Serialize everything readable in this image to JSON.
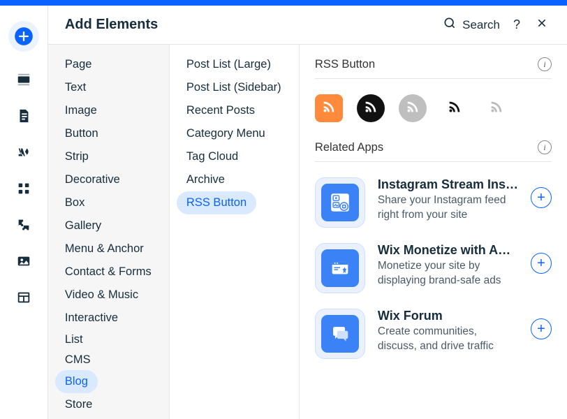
{
  "header": {
    "title": "Add Elements",
    "search_label": "Search",
    "help_label": "?"
  },
  "rail": {
    "items": [
      {
        "name": "add-icon"
      },
      {
        "name": "section-icon"
      },
      {
        "name": "page-icon"
      },
      {
        "name": "theme-icon"
      },
      {
        "name": "apps-icon"
      },
      {
        "name": "plugins-icon"
      },
      {
        "name": "media-icon"
      },
      {
        "name": "layout-icon"
      }
    ]
  },
  "categories": [
    {
      "label": "Page",
      "selected": false
    },
    {
      "label": "Text",
      "selected": false
    },
    {
      "label": "Image",
      "selected": false
    },
    {
      "label": "Button",
      "selected": false
    },
    {
      "label": "Strip",
      "selected": false
    },
    {
      "label": "Decorative",
      "selected": false
    },
    {
      "label": "Box",
      "selected": false
    },
    {
      "label": "Gallery",
      "selected": false
    },
    {
      "label": "Menu & Anchor",
      "selected": false
    },
    {
      "label": "Contact & Forms",
      "selected": false
    },
    {
      "label": "Video & Music",
      "selected": false
    },
    {
      "label": "Interactive",
      "selected": false
    },
    {
      "label": "List",
      "selected": false,
      "tight": true
    },
    {
      "label": "CMS",
      "selected": false,
      "tight": true
    },
    {
      "label": "Blog",
      "selected": true
    },
    {
      "label": "Store",
      "selected": false
    }
  ],
  "subcategories": [
    {
      "label": "Post List (Large)",
      "selected": false
    },
    {
      "label": "Post List (Sidebar)",
      "selected": false
    },
    {
      "label": "Recent Posts",
      "selected": false
    },
    {
      "label": "Category Menu",
      "selected": false
    },
    {
      "label": "Tag Cloud",
      "selected": false
    },
    {
      "label": "Archive",
      "selected": false
    },
    {
      "label": "RSS Button",
      "selected": true
    }
  ],
  "detail": {
    "rss_section_title": "RSS Button",
    "related_apps_title": "Related Apps",
    "rss_variants": [
      {
        "style": "orange"
      },
      {
        "style": "black"
      },
      {
        "style": "gray"
      },
      {
        "style": "outline-black"
      },
      {
        "style": "outline-gray"
      }
    ],
    "apps": [
      {
        "title": "Instagram Stream Ins…",
        "desc": "Share your Instagram feed right from your site",
        "icon": "instagram"
      },
      {
        "title": "Wix Monetize with A…",
        "desc": "Monetize your site by displaying brand-safe ads",
        "icon": "monetize"
      },
      {
        "title": "Wix Forum",
        "desc": "Create communities, discuss, and drive traffic",
        "icon": "forum"
      }
    ]
  },
  "colors": {
    "accent": "#0a62ff",
    "rss_orange": "#ff8a3c"
  }
}
